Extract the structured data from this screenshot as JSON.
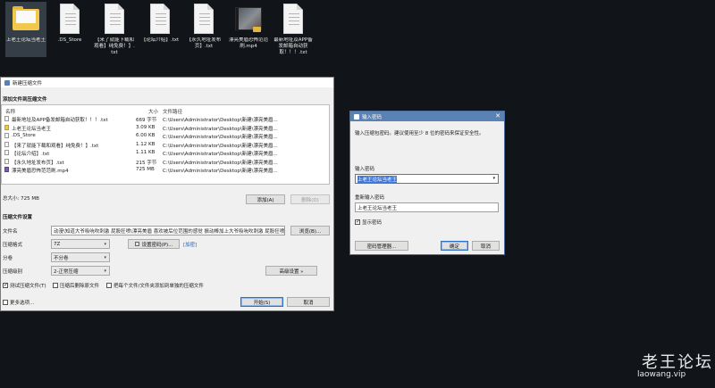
{
  "desktop": {
    "icons": [
      {
        "label": "上老王论坛当老王",
        "kind": "folder"
      },
      {
        "label": ".DS_Store",
        "kind": "file"
      },
      {
        "label": "【来了就能下载和观看】纯免费！】.txt",
        "kind": "file"
      },
      {
        "label": "【论坛介绍】.txt",
        "kind": "file"
      },
      {
        "label": "【永久地址发布页】.txt",
        "kind": "file"
      },
      {
        "label": "漂亮美眉恐怖范范刷.mp4",
        "kind": "video"
      },
      {
        "label": "最新地址及APP备发邮箱自动获取！！！.txt",
        "kind": "file"
      }
    ]
  },
  "archive_dialog": {
    "title": "新建压缩文件",
    "section_add": "添加文件到压缩文件",
    "columns": [
      "名称",
      "大小",
      "文件路径"
    ],
    "files": [
      {
        "name": "最新地址及APP备发邮箱自动获取！！！.txt",
        "size": "669 字节",
        "path": "C:\\Users\\Administrator\\Desktop\\新建\\漂亮美眉...",
        "kind": "file"
      },
      {
        "name": "上老王论坛当老王",
        "size": "3.09 KB",
        "path": "C:\\Users\\Administrator\\Desktop\\新建\\漂亮美眉...",
        "kind": "folder"
      },
      {
        "name": ".DS_Store",
        "size": "6.00 KB",
        "path": "C:\\Users\\Administrator\\Desktop\\新建\\漂亮美眉...",
        "kind": "file"
      },
      {
        "name": "【来了就能下载和观看】纯免费！】.txt",
        "size": "1.12 KB",
        "path": "C:\\Users\\Administrator\\Desktop\\新建\\漂亮美眉...",
        "kind": "file"
      },
      {
        "name": "【论坛介绍】.txt",
        "size": "1.11 KB",
        "path": "C:\\Users\\Administrator\\Desktop\\新建\\漂亮美眉...",
        "kind": "file"
      },
      {
        "name": "【永久地址发布页】.txt",
        "size": "215 字节",
        "path": "C:\\Users\\Administrator\\Desktop\\新建\\漂亮美眉...",
        "kind": "file"
      },
      {
        "name": "漂亮美眉恐怖范范刷.mp4",
        "size": "725 MB",
        "path": "C:\\Users\\Administrator\\Desktop\\新建\\漂亮美眉...",
        "kind": "video"
      }
    ],
    "total_size": "总大小: 725 MB",
    "add_button": "添加(A)",
    "remove_button": "删除(D)",
    "section_settings": "压缩文件设置",
    "filename_label": "文件名",
    "filename_value": "动漫\\知道大爷吸吮吹刺激 屁股狂喷\\漂亮美眉 喜欢被后位范围的感觉 振动棒加上大爷吸吮吹刺激 屁股狂喷.7z",
    "browse_button": "浏览(B)...",
    "format_label": "压缩格式",
    "format_value": "7Z",
    "set_password_button": "设置密码(P)...",
    "encrypted_tag": "[加密]",
    "split_label": "分卷",
    "split_value": "不分卷",
    "level_label": "压缩级别",
    "level_value": "2-正常压缩",
    "advanced_button": "高级设置 »",
    "opt_test": "测试压缩文件(T)",
    "opt_delete": "压缩后删除原文件",
    "opt_each": "把每个文件/文件夹添加到单独的压缩文件",
    "more_options": "更多选项...",
    "start_button": "开始(S)",
    "cancel_button": "取消"
  },
  "password_dialog": {
    "title": "输入密码",
    "hint": "输入压缩包密码。建议使用至少 8 位的密码来保证安全性。",
    "pwd_label": "输入密码",
    "pwd_value": "上老王论坛当老王",
    "confirm_label": "重新输入密码",
    "confirm_value": "上老王论坛当老王",
    "show_pwd": "显示密码",
    "manager_button": "密码管理器...",
    "ok_button": "确定",
    "cancel_button": "取消"
  },
  "watermark": {
    "title": "老王论坛",
    "url": "laowang.vip"
  }
}
